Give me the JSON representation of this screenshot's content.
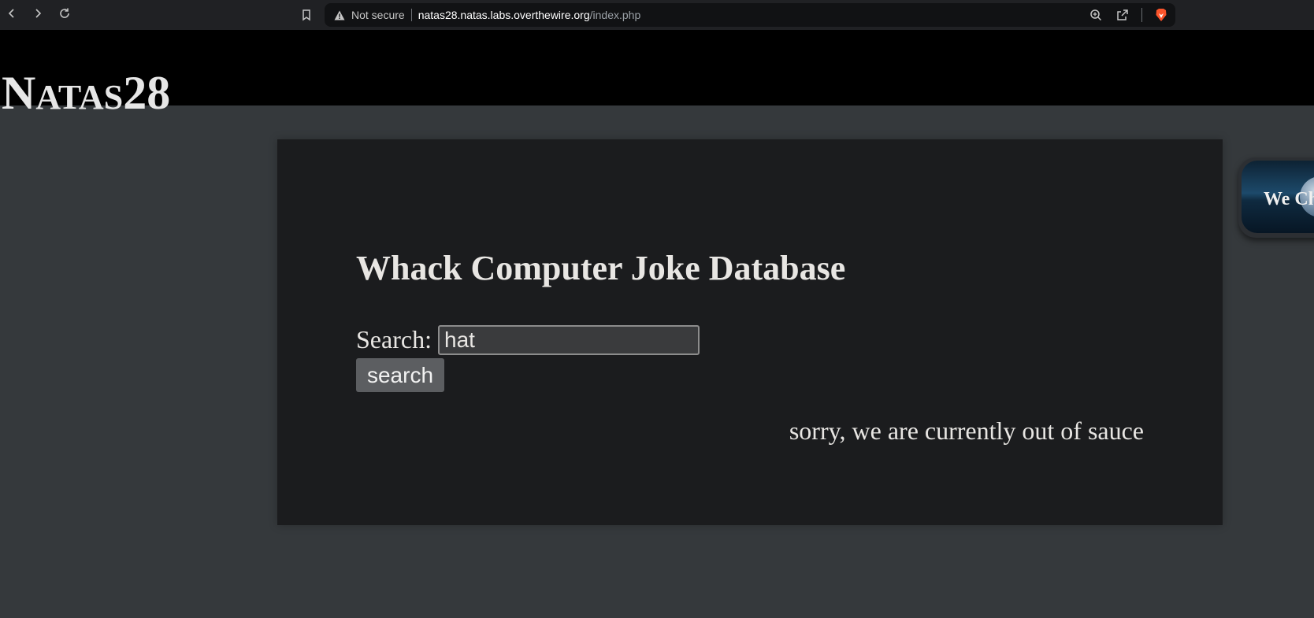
{
  "browser": {
    "security_label": "Not secure",
    "url_host": "natas28.natas.labs.overthewire.org",
    "url_path": "/index.php"
  },
  "site": {
    "title_big_prefix": "N",
    "title_small": "ATAS",
    "title_big_suffix": "28"
  },
  "main": {
    "heading": "Whack Computer Joke Database",
    "search_label": "Search:",
    "search_value": "hat",
    "search_button": "search",
    "result_text": "sorry, we are currently out of sauce"
  },
  "badge": {
    "text": "We Ch"
  },
  "icons": {
    "back": "back-arrow-icon",
    "forward": "forward-arrow-icon",
    "reload": "reload-icon",
    "bookmark": "bookmark-icon",
    "warning": "warning-triangle-icon",
    "zoom": "zoom-in-icon",
    "share": "share-icon",
    "brave": "brave-shield-icon",
    "globe": "globe-icon"
  },
  "colors": {
    "page_bg": "#35393c",
    "header_bg": "#000000",
    "content_bg": "#1b1c1e",
    "text": "#e8e6e3",
    "button_bg": "#5c5e61",
    "brave_orange": "#fb542b"
  }
}
